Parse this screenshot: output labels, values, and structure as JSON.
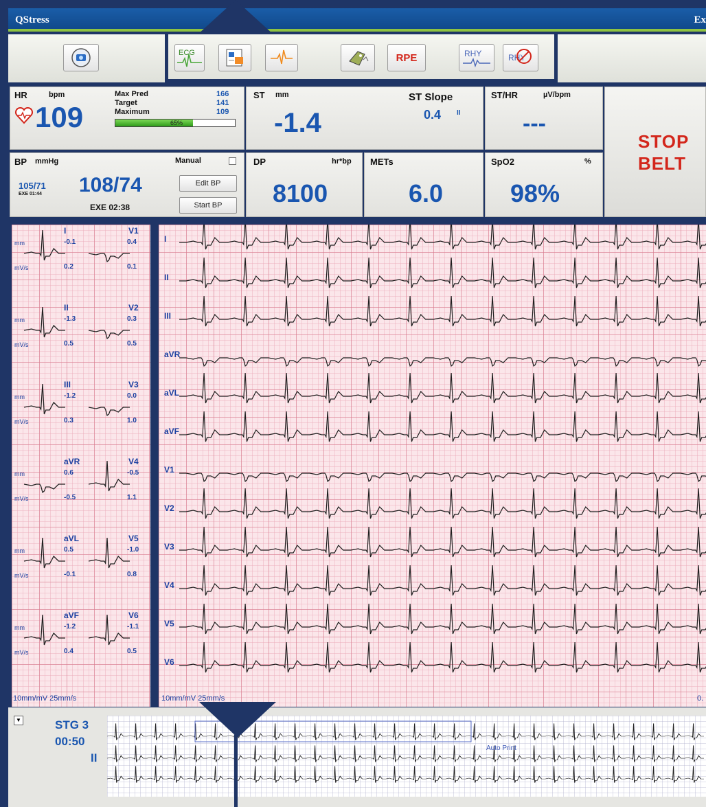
{
  "titlebar": {
    "app": "QStress",
    "right": "Ex"
  },
  "toolbar": {
    "buttons": [
      {
        "icon": "camera-icon"
      },
      {
        "label": "ECG",
        "icon": "ecg-icon"
      },
      {
        "icon": "report-icon"
      },
      {
        "icon": "waveform-icon"
      },
      {
        "icon": "tag-icon"
      },
      {
        "label": "RPE"
      },
      {
        "label": "RHY",
        "icon": "rhythm-icon"
      },
      {
        "label": "RHY",
        "icon": "rhythm-off-icon"
      }
    ]
  },
  "hr": {
    "label": "HR",
    "unit": "bpm",
    "value": "109",
    "max_pred_label": "Max Pred",
    "max_pred": "166",
    "target_label": "Target",
    "target": "141",
    "maximum_label": "Maximum",
    "maximum": "109",
    "progress_pct": "65%",
    "progress": 0.65
  },
  "st": {
    "label": "ST",
    "unit": "mm",
    "value": "-1.4",
    "slope_label": "ST Slope",
    "slope_value": "0.4",
    "slope_lead": "II"
  },
  "sthr": {
    "label": "ST/HR",
    "unit": "µV/bpm",
    "value": "---"
  },
  "stop_belt": {
    "line1": "STOP",
    "line2": "BELT"
  },
  "bp": {
    "label": "BP",
    "unit": "mmHg",
    "prev": "105/71",
    "prev_time": "EXE 01:44",
    "value": "108/74",
    "time": "EXE 02:38",
    "manual_label": "Manual",
    "edit_label": "Edit BP",
    "start_label": "Start BP"
  },
  "dp": {
    "label": "DP",
    "unit": "hr*bp",
    "value": "8100"
  },
  "mets": {
    "label": "METs",
    "value": "6.0"
  },
  "spo2": {
    "label": "SpO2",
    "unit": "%",
    "value": "98%"
  },
  "median": {
    "mm": "mm",
    "mvs": "mV/s",
    "left": [
      {
        "lead": "I",
        "st": "-0.1",
        "slope": "0.2"
      },
      {
        "lead": "II",
        "st": "-1.3",
        "slope": "0.5"
      },
      {
        "lead": "III",
        "st": "-1.2",
        "slope": "0.3"
      },
      {
        "lead": "aVR",
        "st": "0.6",
        "slope": "-0.5"
      },
      {
        "lead": "aVL",
        "st": "0.5",
        "slope": "-0.1"
      },
      {
        "lead": "aVF",
        "st": "-1.2",
        "slope": "0.4"
      }
    ],
    "right": [
      {
        "lead": "V1",
        "st": "0.4",
        "slope": "0.1"
      },
      {
        "lead": "V2",
        "st": "0.3",
        "slope": "0.5"
      },
      {
        "lead": "V3",
        "st": "0.0",
        "slope": "1.0"
      },
      {
        "lead": "V4",
        "st": "-0.5",
        "slope": "1.1"
      },
      {
        "lead": "V5",
        "st": "-1.0",
        "slope": "0.8"
      },
      {
        "lead": "V6",
        "st": "-1.1",
        "slope": "0.5"
      }
    ],
    "scale": "10mm/mV  25mm/s"
  },
  "leads": [
    "I",
    "II",
    "III",
    "aVR",
    "aVL",
    "aVF",
    "V1",
    "V2",
    "V3",
    "V4",
    "V5",
    "V6"
  ],
  "live_scale": "10mm/mV  25mm/s",
  "live_right_label": "0.",
  "strip": {
    "stage": "STG 3",
    "time": "00:50",
    "lead": "II",
    "autoprint": "Auto Print",
    "dropdown": "▼"
  }
}
